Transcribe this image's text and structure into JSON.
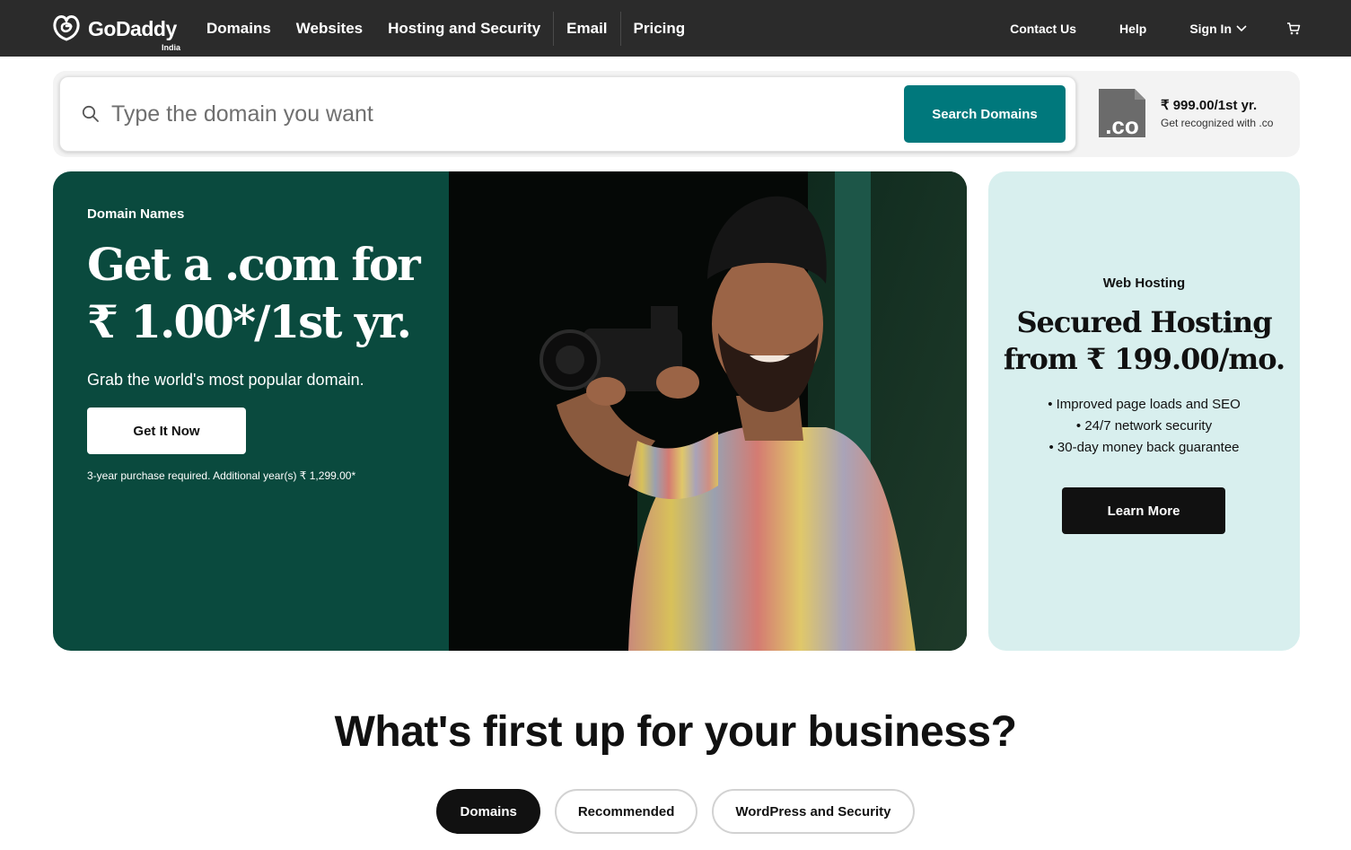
{
  "brand": {
    "name": "GoDaddy",
    "region": "India"
  },
  "nav": {
    "items": [
      "Domains",
      "Websites",
      "Hosting and Security",
      "Email",
      "Pricing"
    ],
    "right": {
      "contact": "Contact Us",
      "help": "Help",
      "sign_in": "Sign In"
    },
    "icons": {
      "logo": "godaddy-logo-icon",
      "chevron": "chevron-down-icon",
      "cart": "cart-icon"
    }
  },
  "search": {
    "placeholder": "Type the domain you want",
    "value": "",
    "button": "Search Domains",
    "icon": "search-icon"
  },
  "promo": {
    "tld": ".co",
    "price": "₹ 999.00/1st yr.",
    "subtitle": "Get recognized with .co",
    "icon": "co-tld-icon"
  },
  "hero": {
    "eyebrow": "Domain Names",
    "title": "Get a .com for ₹ 1.00*/1st yr.",
    "subtitle": "Grab the world's most popular domain.",
    "cta": "Get It Now",
    "fine_print": "3-year purchase required. Additional year(s) ₹ 1,299.00*",
    "bg_color": "#0a4a3e"
  },
  "hosting": {
    "eyebrow": "Web Hosting",
    "title": "Secured Hosting from ₹ 199.00/mo.",
    "features": [
      "• Improved page loads and SEO",
      "• 24/7 network security",
      "• 30-day money back guarantee"
    ],
    "cta": "Learn More",
    "bg_color": "#d8efee"
  },
  "section": {
    "title": "What's first up for your business?",
    "tabs": [
      "Domains",
      "Recommended",
      "WordPress and Security"
    ],
    "active_tab": "Domains"
  },
  "colors": {
    "nav_bg": "#2b2b2b",
    "accent": "#00787c",
    "dark_button": "#111111"
  }
}
